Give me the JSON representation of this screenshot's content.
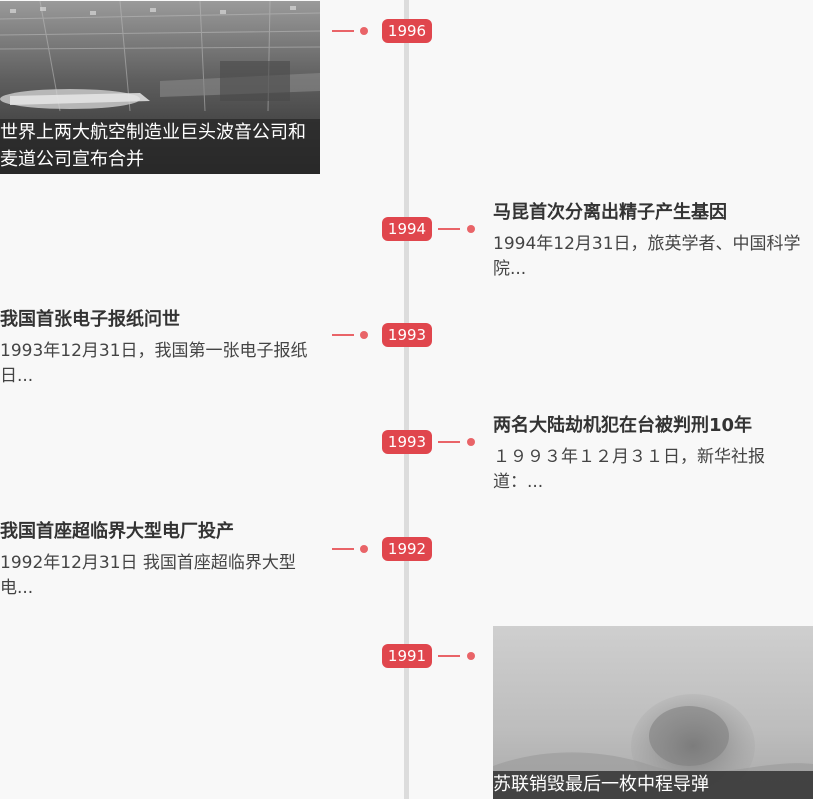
{
  "timeline": {
    "events": [
      {
        "year": "1996",
        "title": "世界上两大航空制造业巨头波音公司和麦道公司宣布合并",
        "summary": ""
      },
      {
        "year": "1994",
        "title": "马昆首次分离出精子产生基因",
        "summary": "1994年12月31日，旅英学者、中国科学院..."
      },
      {
        "year": "1993",
        "title": "我国首张电子报纸问世",
        "summary": "1993年12月31日，我国第一张电子报纸日..."
      },
      {
        "year": "1993",
        "title": "两名大陆劫机犯在台被判刑10年",
        "summary": "１９９３年１２月３１日，新华社报道：..."
      },
      {
        "year": "1992",
        "title": "我国首座超临界大型电厂投产",
        "summary": "1992年12月31日 我国首座超临界大型电..."
      },
      {
        "year": "1991",
        "title": "苏联销毁最后一枚中程导弹",
        "summary": ""
      }
    ]
  },
  "colors": {
    "accent": "#e0464d",
    "connector": "#e96468",
    "axis": "#dcdcdc",
    "background": "#f8f8f8"
  }
}
